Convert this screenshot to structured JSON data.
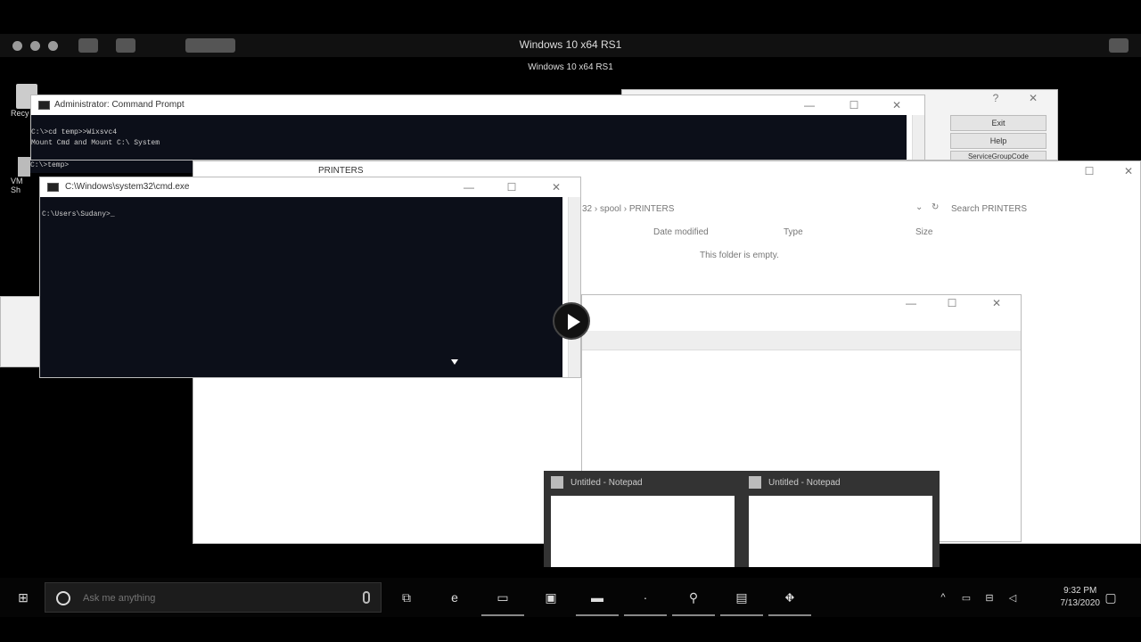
{
  "host": {
    "title": "Windows 10 x64 RS1",
    "subtitle": "Windows 10 x64 RS1"
  },
  "desktop_icons": [
    {
      "label": "Recy"
    },
    {
      "label": "VM"
    },
    {
      "label": "Sh"
    }
  ],
  "admin_cmd": {
    "title": "Administrator: Command Prompt",
    "lines": [
      "C:\\>cd temp>>Wixsvc4",
      "Mount Cmd and Mount C:\\ System",
      "",
      "",
      "C:\\>temp>"
    ]
  },
  "cmd_front": {
    "title": "C:\\Windows\\system32\\cmd.exe",
    "prompt": "C:\\Users\\Sudany>_"
  },
  "right_panel": {
    "buttons": [
      "Exit",
      "Help",
      "ServiceGroupCode"
    ]
  },
  "explorer": {
    "title": "PRINTERS",
    "breadcrumb": [
      "32",
      "spool",
      "PRINTERS"
    ],
    "search_placeholder": "Search PRINTERS",
    "columns": [
      "Date modified",
      "Type",
      "Size"
    ],
    "empty_text": "This folder is empty."
  },
  "notepad_previews": [
    {
      "title": "Untitled - Notepad"
    },
    {
      "title": "Untitled - Notepad"
    }
  ],
  "taskbar": {
    "search_placeholder": "Ask me anything",
    "time": "9:32 PM",
    "date": "7/13/2020"
  }
}
